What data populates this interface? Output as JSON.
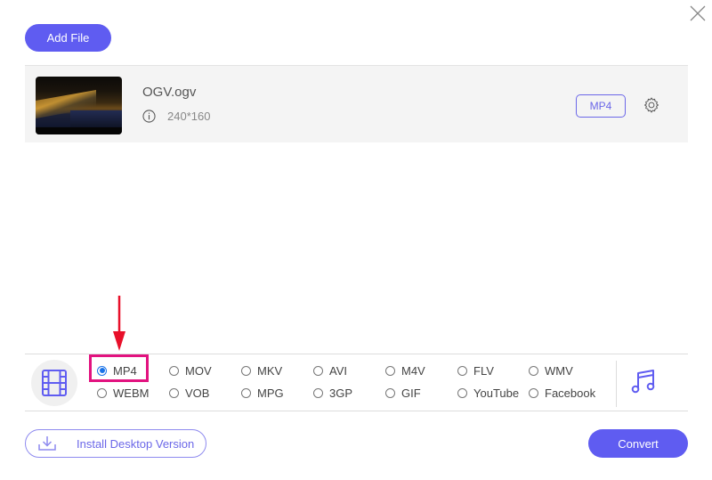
{
  "toolbar": {
    "add_file_label": "Add File"
  },
  "file": {
    "name": "OGV.ogv",
    "resolution": "240*160",
    "output_format": "MP4"
  },
  "formats": {
    "selected": "MP4",
    "video_options": [
      {
        "label": "MP4",
        "checked": true
      },
      {
        "label": "MOV",
        "checked": false
      },
      {
        "label": "MKV",
        "checked": false
      },
      {
        "label": "AVI",
        "checked": false
      },
      {
        "label": "M4V",
        "checked": false
      },
      {
        "label": "FLV",
        "checked": false
      },
      {
        "label": "WMV",
        "checked": false
      },
      {
        "label": "WEBM",
        "checked": false
      },
      {
        "label": "VOB",
        "checked": false
      },
      {
        "label": "MPG",
        "checked": false
      },
      {
        "label": "3GP",
        "checked": false
      },
      {
        "label": "GIF",
        "checked": false
      },
      {
        "label": "YouTube",
        "checked": false
      },
      {
        "label": "Facebook",
        "checked": false
      }
    ]
  },
  "footer": {
    "install_label": "Install Desktop Version",
    "convert_label": "Convert"
  },
  "colors": {
    "accent": "#5f5cf1",
    "highlight": "#e2127f",
    "arrow": "#e8102a",
    "radio_checked": "#1a73e8"
  }
}
